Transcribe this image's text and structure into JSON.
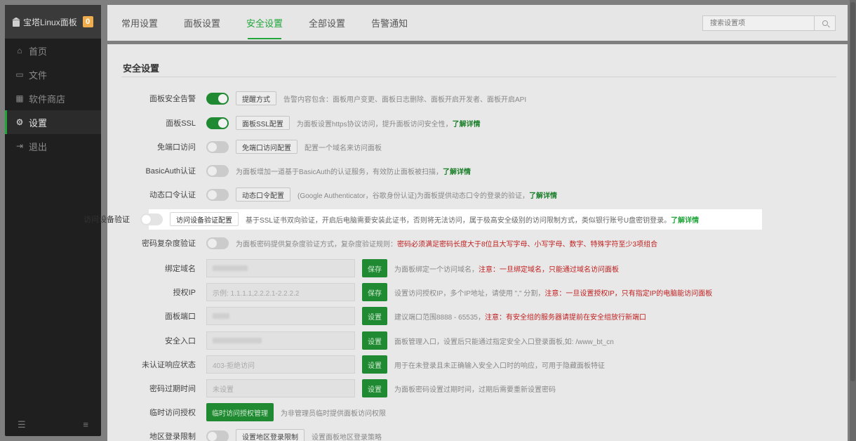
{
  "sidebar": {
    "brand": "宝塔Linux面板",
    "badge": "0",
    "items": [
      {
        "icon": "home-icon",
        "glyph": "⌂",
        "label": "首页"
      },
      {
        "icon": "folder-icon",
        "glyph": "▭",
        "label": "文件"
      },
      {
        "icon": "grid-icon",
        "glyph": "▦",
        "label": "软件商店"
      },
      {
        "icon": "gear-icon",
        "glyph": "⚙",
        "label": "设置"
      },
      {
        "icon": "logout-icon",
        "glyph": "⇥",
        "label": "退出"
      }
    ],
    "footer_left_icon": "collapse-icon",
    "footer_right_icon": "menu-icon"
  },
  "tabs": [
    "常用设置",
    "面板设置",
    "安全设置",
    "全部设置",
    "告警通知"
  ],
  "active_tab": "安全设置",
  "search": {
    "placeholder": "搜索设置项"
  },
  "section_title": "安全设置",
  "rows": {
    "alarm": {
      "label": "面板安全告警",
      "on": true,
      "button": "提醒方式",
      "desc": "告警内容包含：面板用户变更、面板日志删除、面板开启开发者、面板开启API"
    },
    "ssl": {
      "label": "面板SSL",
      "on": true,
      "button": "面板SSL配置",
      "desc": "为面板设置https协议访问，提升面板访问安全性，",
      "link": "了解详情"
    },
    "noport": {
      "label": "免端口访问",
      "on": false,
      "button": "免端口访问配置",
      "desc": "配置一个域名来访问面板"
    },
    "basicauth": {
      "label": "BasicAuth认证",
      "on": false,
      "desc": "为面板增加一道基于BasicAuth的认证服务，有效防止面板被扫描，",
      "link": "了解详情"
    },
    "totp": {
      "label": "动态口令认证",
      "on": false,
      "button": "动态口令配置",
      "desc": "(Google Authenticator，谷歌身份认证)为面板提供动态口令的登录的验证，",
      "link": "了解详情"
    },
    "device": {
      "label": "访问设备验证",
      "on": false,
      "button": "访问设备验证配置",
      "desc": "基于SSL证书双向验证，开启后电脑需要安装此证书，否则将无法访问，属于极高安全级别的访问限制方式，类似银行账号U盘密钥登录。",
      "link": "了解详情"
    },
    "complexity": {
      "label": "密码复杂度验证",
      "on": false,
      "desc": "为面板密码提供复杂度验证方式，复杂度验证规则：",
      "red": "密码必须满足密码长度大于8位且大写字母、小写字母、数字、特殊字符至少3项组合"
    },
    "domain": {
      "label": "绑定域名",
      "button": "保存",
      "desc": "为面板绑定一个访问域名，",
      "red": "注意：一旦绑定域名，只能通过域名访问面板"
    },
    "ip": {
      "label": "授权IP",
      "placeholder": "示例: 1.1.1.1,2.2.2.1-2.2.2.2",
      "button": "保存",
      "desc": "设置访问授权IP，多个IP地址，请使用 \",\" 分割，",
      "red": "注意：一旦设置授权IP，只有指定IP的电脑能访问面板"
    },
    "port": {
      "label": "面板端口",
      "button": "设置",
      "desc": "建议端口范围8888 - 65535，",
      "red": "注意：有安全组的服务器请提前在安全组放行新端口"
    },
    "entry": {
      "label": "安全入口",
      "button": "设置",
      "desc": "面板管理入口，设置后只能通过指定安全入口登录面板,如: /www_bt_cn"
    },
    "unauth": {
      "label": "未认证响应状态",
      "value": "403-拒绝访问",
      "button": "设置",
      "desc": "用于在未登录且未正确输入安全入口时的响应，可用于隐藏面板特征"
    },
    "expire": {
      "label": "密码过期时间",
      "value": "未设置",
      "button": "设置",
      "desc": "为面板密码设置过期时间，过期后需要重新设置密码"
    },
    "temp": {
      "label": "临时访问授权",
      "button": "临时访问授权管理",
      "desc": "为非管理员临时提供面板访问权限"
    },
    "region": {
      "label": "地区登录限制",
      "on": false,
      "button": "设置地区登录限制",
      "desc": "设置面板地区登录策略"
    }
  }
}
